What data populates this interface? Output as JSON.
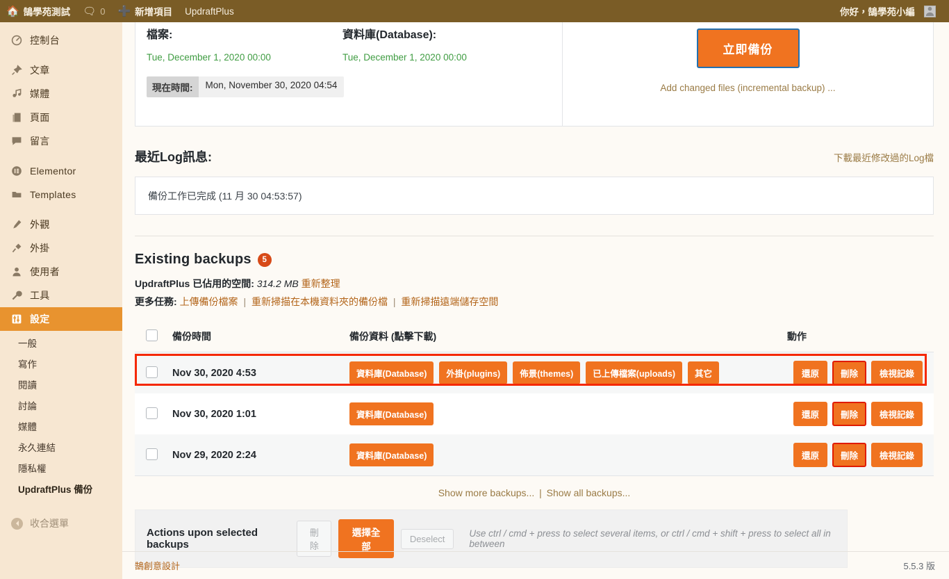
{
  "adminbar": {
    "home_icon": "home-icon",
    "site_name": "鵠學苑測試",
    "comments_icon": "comment-icon",
    "comments_count": "0",
    "new_icon": "plus-icon",
    "new_label": "新增項目",
    "plugin_label": "UpdraftPlus",
    "greeting": "你好，鵠學苑小編",
    "avatar": "user-avatar-icon"
  },
  "sidebar": {
    "items": [
      {
        "label": "控制台",
        "icon": "dashboard-icon"
      },
      {
        "label": "文章",
        "icon": "pin-icon"
      },
      {
        "label": "媒體",
        "icon": "media-icon"
      },
      {
        "label": "頁面",
        "icon": "page-icon"
      },
      {
        "label": "留言",
        "icon": "comment-icon"
      },
      {
        "label": "Elementor",
        "icon": "elementor-icon"
      },
      {
        "label": "Templates",
        "icon": "folder-icon"
      },
      {
        "label": "外觀",
        "icon": "brush-icon"
      },
      {
        "label": "外掛",
        "icon": "plug-icon"
      },
      {
        "label": "使用者",
        "icon": "user-icon"
      },
      {
        "label": "工具",
        "icon": "wrench-icon"
      },
      {
        "label": "設定",
        "icon": "settings-icon",
        "active": true
      }
    ],
    "submenu": [
      {
        "label": "一般"
      },
      {
        "label": "寫作"
      },
      {
        "label": "閱讀"
      },
      {
        "label": "討論"
      },
      {
        "label": "媒體"
      },
      {
        "label": "永久連結"
      },
      {
        "label": "隱私權"
      },
      {
        "label": "UpdraftPlus 備份",
        "current": true
      }
    ],
    "collapse_label": "收合選單",
    "collapse_icon": "chevron-left-circle-icon"
  },
  "status_panel": {
    "files_heading": "檔案:",
    "files_next": "Tue, December 1, 2020 00:00",
    "db_heading": "資料庫(Database):",
    "db_next": "Tue, December 1, 2020 00:00",
    "now_label": "現在時間:",
    "now_value": "Mon, November 30, 2020 04:54",
    "backup_now_label": "立即備份",
    "incremental_link": "Add changed files (incremental backup) ..."
  },
  "log_section": {
    "title": "最近Log訊息:",
    "download_link": "下載最近修改過的Log檔",
    "message": "備份工作已完成 (11 月 30 04:53:57)"
  },
  "existing_backups": {
    "title": "Existing backups",
    "count_badge": "5",
    "space_label": "UpdraftPlus 已佔用的空間:",
    "space_value": "314.2 MB",
    "space_action": "重新整理",
    "more_tasks_label": "更多任務:",
    "more_tasks": [
      "上傳備份檔案",
      "重新掃描在本機資料夾的備份檔",
      "重新掃描遠端儲存空間"
    ],
    "columns": {
      "checkbox": "",
      "time": "備份時間",
      "data": "備份資料 (點擊下載)",
      "actions": "動作"
    },
    "rows": [
      {
        "time": "Nov 30, 2020 4:53",
        "components": [
          "資料庫(Database)",
          "外掛(plugins)",
          "佈景(themes)",
          "已上傳檔案(uploads)",
          "其它"
        ],
        "actions": [
          {
            "label": "還原",
            "highlight": false
          },
          {
            "label": "刪除",
            "highlight": true
          },
          {
            "label": "檢視記錄",
            "highlight": false
          }
        ],
        "row_highlight": true
      },
      {
        "time": "Nov 30, 2020 1:01",
        "components": [
          "資料庫(Database)"
        ],
        "actions": [
          {
            "label": "還原",
            "highlight": false
          },
          {
            "label": "刪除",
            "highlight": true
          },
          {
            "label": "檢視記錄",
            "highlight": false
          }
        ],
        "row_highlight": false
      },
      {
        "time": "Nov 29, 2020 2:24",
        "components": [
          "資料庫(Database)"
        ],
        "actions": [
          {
            "label": "還原",
            "highlight": false
          },
          {
            "label": "刪除",
            "highlight": true
          },
          {
            "label": "檢視記錄",
            "highlight": false
          }
        ],
        "row_highlight": false
      }
    ],
    "show_more": "Show more backups...",
    "show_all": "Show all backups...",
    "separator": "|"
  },
  "actions_bar": {
    "title": "Actions upon selected backups",
    "delete_label": "刪除",
    "select_all_label": "選擇全部",
    "deselect_label": "Deselect",
    "hint": "Use ctrl / cmd + press to select several items, or ctrl / cmd + shift + press to select all in between"
  },
  "footer": {
    "credit": "鵠創意設計",
    "version": "5.5.3 版"
  },
  "colors": {
    "adminbar_bg": "#7a5c26",
    "sidebar_bg": "#f7e7d2",
    "accent_orange": "#f07320",
    "active_menu": "#e8932f",
    "badge_red": "#d74a17",
    "highlight_red": "#f52800",
    "link_brown": "#9a7b45",
    "date_green": "#3f9c42"
  }
}
